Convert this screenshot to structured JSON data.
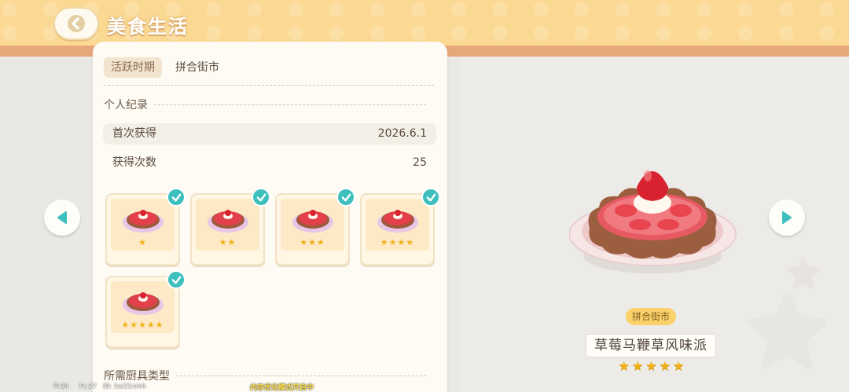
{
  "header": {
    "title": "美食生活",
    "back_icon": "chevron-left-icon"
  },
  "info": {
    "period_tag": "活跃时期",
    "period_value": "拼合街市",
    "personal_record_heading": "个人纪录",
    "records": [
      {
        "label": "首次获得",
        "value": "2026.6.1"
      },
      {
        "label": "获得次数",
        "value": "25"
      }
    ],
    "variants": [
      {
        "stars": "★",
        "star_count": 1,
        "collected": true
      },
      {
        "stars": "★★",
        "star_count": 2,
        "collected": true
      },
      {
        "stars": "★★★",
        "star_count": 3,
        "collected": true
      },
      {
        "stars": "★★★★",
        "star_count": 4,
        "collected": true
      },
      {
        "stars": "★★★★★",
        "star_count": 5,
        "collected": true
      }
    ],
    "utensil_heading": "所需厨具类型"
  },
  "showcase": {
    "source_tag": "拼合街市",
    "dish_name": "草莓马鞭草风味派",
    "stars": "★★★★★",
    "star_count": 5
  },
  "nav": {
    "prev_icon": "triangle-left-icon",
    "next_icon": "triangle-right-icon"
  },
  "debug": {
    "fi": "Fi:24",
    "fc": "Fc:27",
    "id": "ID: 1e/21nmh",
    "memory_notice": "内存优化模式开启中"
  },
  "colors": {
    "banner": "#fbd993",
    "accent_teal": "#3dbfbd",
    "star_gold": "#f3b11a",
    "source_tag": "#fbd26a"
  }
}
